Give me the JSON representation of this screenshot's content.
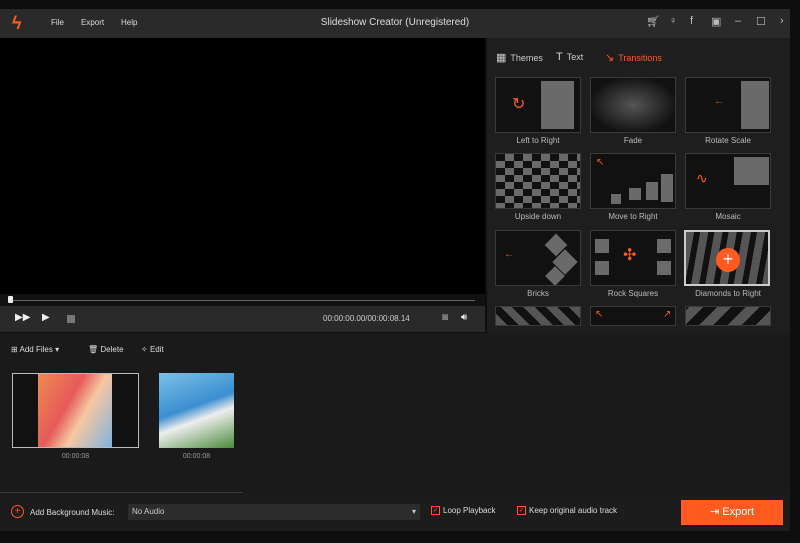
{
  "app": {
    "title": "Slideshow Creator (Unregistered)",
    "menu": [
      "File",
      "Export",
      "Help"
    ],
    "window_icons": [
      "cart-icon",
      "key-icon",
      "facebook-icon",
      "feedback-icon",
      "minimize-icon",
      "maximize-icon",
      "close-icon"
    ]
  },
  "player": {
    "time": "00:00:00.00/00:00:08.14",
    "progress": 0
  },
  "panel": {
    "tabs": [
      {
        "label": "Themes",
        "icon": "grid-icon"
      },
      {
        "label": "Text",
        "icon": "text-icon"
      },
      {
        "label": "Transitions",
        "icon": "transition-icon",
        "active": true
      }
    ],
    "transitions": [
      "Left to Right",
      "Fade",
      "Rotate Scale",
      "Upside down",
      "Move to Right",
      "Mosaic",
      "Bricks",
      "Rock Squares",
      "Diamonds to Right"
    ],
    "selected": "Diamonds to Right"
  },
  "toolbar": {
    "add_files": "Add Files",
    "delete": "Delete",
    "edit": "Edit"
  },
  "files": [
    {
      "duration": "00:00:08"
    },
    {
      "duration": "00:00:08"
    }
  ],
  "bottom": {
    "music_label": "Add Background Music:",
    "audio": "No Audio",
    "loop": "Loop Playback",
    "loop_checked": true,
    "keep_audio": "Keep original audio track",
    "keep_checked": true,
    "export": "Export"
  },
  "colors": {
    "accent": "#ff5a1f",
    "titlebar": "#2a2a2a"
  }
}
